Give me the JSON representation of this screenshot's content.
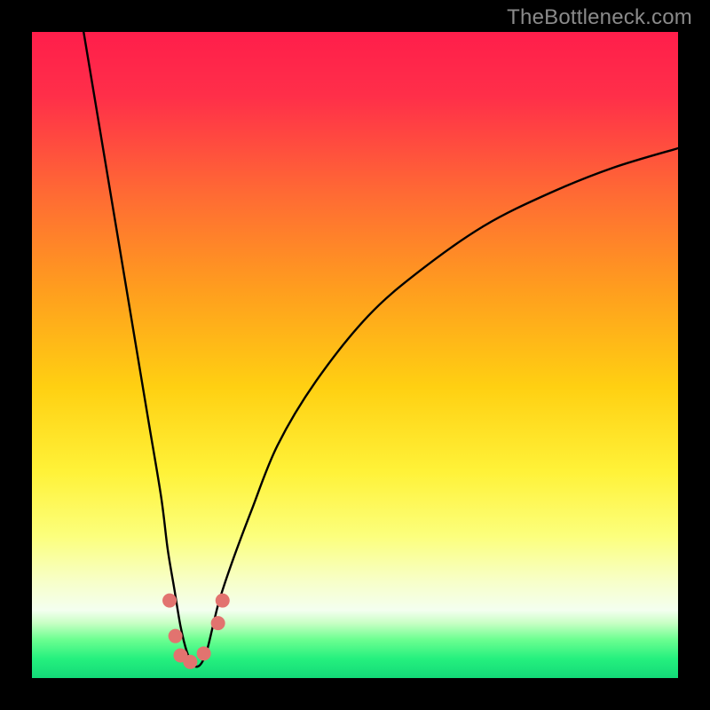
{
  "watermark": "TheBottleneck.com",
  "chart_data": {
    "type": "line",
    "title": "",
    "xlabel": "",
    "ylabel": "",
    "x_range": [
      0,
      100
    ],
    "y_range": [
      0,
      100
    ],
    "grid": false,
    "gradient_stops": [
      {
        "offset": 0.0,
        "color": "#ff1e4b"
      },
      {
        "offset": 0.1,
        "color": "#ff2f49"
      },
      {
        "offset": 0.25,
        "color": "#ff6a34"
      },
      {
        "offset": 0.4,
        "color": "#ff9e1e"
      },
      {
        "offset": 0.55,
        "color": "#ffd012"
      },
      {
        "offset": 0.68,
        "color": "#fff238"
      },
      {
        "offset": 0.78,
        "color": "#fcff7c"
      },
      {
        "offset": 0.85,
        "color": "#f7ffc8"
      },
      {
        "offset": 0.895,
        "color": "#f4fff0"
      },
      {
        "offset": 0.915,
        "color": "#c8ffc4"
      },
      {
        "offset": 0.94,
        "color": "#6dff91"
      },
      {
        "offset": 0.97,
        "color": "#25f07e"
      },
      {
        "offset": 1.0,
        "color": "#13da78"
      }
    ],
    "series": [
      {
        "name": "bottleneck-curve",
        "x": [
          8,
          10,
          12,
          14,
          16,
          18,
          20,
          21,
          22,
          23,
          24,
          25,
          26,
          27,
          28,
          29,
          31,
          34,
          38,
          44,
          52,
          60,
          70,
          80,
          90,
          100
        ],
        "y": [
          100,
          88,
          76,
          64,
          52,
          40,
          28,
          20,
          14,
          8,
          4,
          2,
          2,
          4,
          8,
          12,
          18,
          26,
          36,
          46,
          56,
          63,
          70,
          75,
          79,
          82
        ]
      }
    ],
    "markers": [
      {
        "x": 21.3,
        "y": 12.0
      },
      {
        "x": 22.2,
        "y": 6.5
      },
      {
        "x": 23.0,
        "y": 3.5
      },
      {
        "x": 24.5,
        "y": 2.5
      },
      {
        "x": 26.6,
        "y": 3.8
      },
      {
        "x": 28.8,
        "y": 8.5
      },
      {
        "x": 29.5,
        "y": 12.0
      }
    ],
    "marker_style": {
      "color": "#e2736f",
      "radius_px": 8
    }
  }
}
